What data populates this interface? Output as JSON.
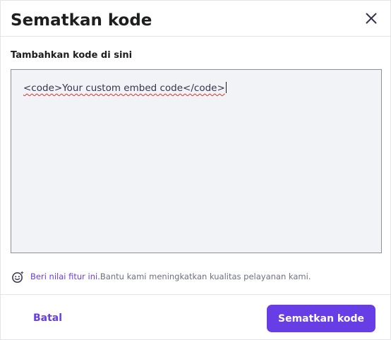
{
  "dialog": {
    "title": "Sematkan kode",
    "close_icon": "close-icon"
  },
  "form": {
    "label": "Tambahkan kode di sini",
    "code_value": "<code>Your custom embed code</code>"
  },
  "feedback": {
    "icon": "smiley-sparkle-icon",
    "link_text": "Beri nilai fitur ini.",
    "message": " Bantu kami meningkatkan kualitas pelayanan kami."
  },
  "footer": {
    "cancel_label": "Batal",
    "submit_label": "Sematkan kode"
  },
  "colors": {
    "accent": "#673de6",
    "text": "#1d1e20",
    "input_bg": "#f2f3f6",
    "muted": "#6d7081"
  }
}
